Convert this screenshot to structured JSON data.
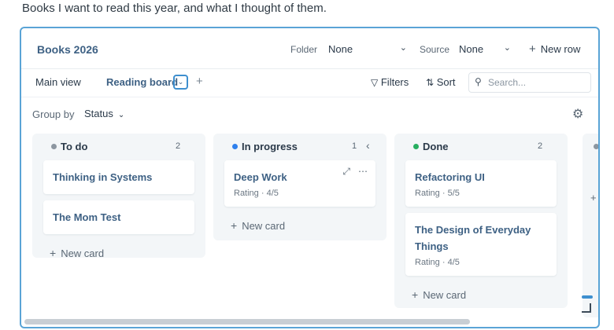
{
  "intro_text": "Books I want to read this year, and what I thought of them.",
  "database": {
    "title": "Books 2026",
    "folder_label": "Folder",
    "folder_value": "None",
    "source_label": "Source",
    "source_value": "None",
    "new_row_label": "New row"
  },
  "views": {
    "main_label": "Main view",
    "board_label": "Reading board",
    "filters_label": "Filters",
    "sort_label": "Sort",
    "search_placeholder": "Search..."
  },
  "group": {
    "label": "Group by",
    "value": "Status"
  },
  "columns": [
    {
      "name": "To do",
      "count": "2",
      "color": "#8c96a0",
      "cards": [
        {
          "title": "Thinking in Systems"
        },
        {
          "title": "The Mom Test"
        }
      ],
      "new_card": "New card"
    },
    {
      "name": "In progress",
      "count": "1",
      "color": "#2f80ed",
      "cards": [
        {
          "title": "Deep Work",
          "field": "Rating · 4/5"
        }
      ],
      "new_card": "New card"
    },
    {
      "name": "Done",
      "count": "2",
      "color": "#27ae60",
      "cards": [
        {
          "title": "Refactoring UI",
          "field": "Rating · 5/5"
        },
        {
          "title": "The Design of Everyday Things",
          "field": "Rating · 4/5"
        }
      ],
      "new_card": "New card"
    }
  ],
  "icons": {
    "chevron": "chevron-down-icon",
    "plus": "plus-icon",
    "filter": "filter-icon",
    "sort": "sort-icon",
    "search": "search-icon",
    "gear": "gear-icon",
    "expand": "expand-icon",
    "more": "more-icon",
    "collapse": "chevron-left-icon"
  },
  "accent_color": "#3e8fcf"
}
